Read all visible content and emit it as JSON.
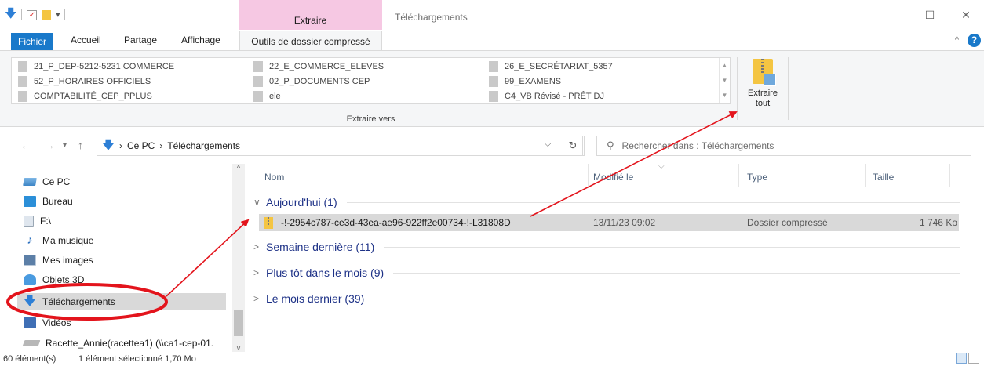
{
  "titlebar": {
    "context_tab": "Extraire",
    "window_title": "Téléchargements",
    "minimize": "—",
    "maximize": "☐",
    "close": "✕"
  },
  "tabs": {
    "fichier": "Fichier",
    "accueil": "Accueil",
    "partage": "Partage",
    "affichage": "Affichage",
    "outils": "Outils de dossier compressé"
  },
  "ribbon": {
    "gallery": [
      [
        "21_P_DEP-5212-5231 COMMERCE",
        "22_E_COMMERCE_ELEVES",
        "26_E_SECRÉTARIAT_5357"
      ],
      [
        "52_P_HORAIRES OFFICIELS",
        "02_P_DOCUMENTS CEP",
        "99_EXAMENS"
      ],
      [
        "COMPTABILITÉ_CEP_PPLUS",
        "ele",
        "C4_VB Révisé - PRÊT DJ"
      ]
    ],
    "group_label": "Extraire vers",
    "extract_all_line1": "Extraire",
    "extract_all_line2": "tout"
  },
  "address": {
    "crumb_pc": "Ce PC",
    "crumb_sep": "›",
    "crumb_folder": "Téléchargements",
    "search_placeholder": "Rechercher dans : Téléchargements"
  },
  "navpane": {
    "items": [
      {
        "label": "Ce PC",
        "icon": "pc-icon"
      },
      {
        "label": "Bureau",
        "icon": "desktop-icon"
      },
      {
        "label": "F:\\",
        "icon": "drive-icon"
      },
      {
        "label": "Ma musique",
        "icon": "music-icon"
      },
      {
        "label": "Mes images",
        "icon": "pictures-icon"
      },
      {
        "label": "Objets 3D",
        "icon": "3d-objects-icon"
      },
      {
        "label": "Téléchargements",
        "icon": "download-icon"
      },
      {
        "label": "Vidéos",
        "icon": "videos-icon"
      },
      {
        "label": "Racette_Annie(racettea1) (\\\\ca1-cep-01.",
        "icon": "network-drive-icon"
      }
    ]
  },
  "filelist": {
    "columns": [
      "Nom",
      "Modifié le",
      "Type",
      "Taille"
    ],
    "groups": [
      {
        "label": "Aujourd'hui (1)",
        "expanded": true
      },
      {
        "label": "Semaine dernière (11)",
        "expanded": false
      },
      {
        "label": "Plus tôt dans le mois (9)",
        "expanded": false
      },
      {
        "label": "Le mois dernier (39)",
        "expanded": false
      }
    ],
    "file": {
      "name": "-!-2954c787-ce3d-43ea-ae96-922ff2e00734-!-L31808D",
      "modified": "13/11/23 09:02",
      "type": "Dossier compressé",
      "size": "1 746 Ko"
    }
  },
  "status": {
    "count": "60 élément(s)",
    "selected": "1 élément sélectionné  1,70 Mo"
  },
  "colors": {
    "accent": "#1979ca",
    "context_tab": "#f6c8e3",
    "selection": "#d9d9d9",
    "annotation": "#e3141c"
  }
}
